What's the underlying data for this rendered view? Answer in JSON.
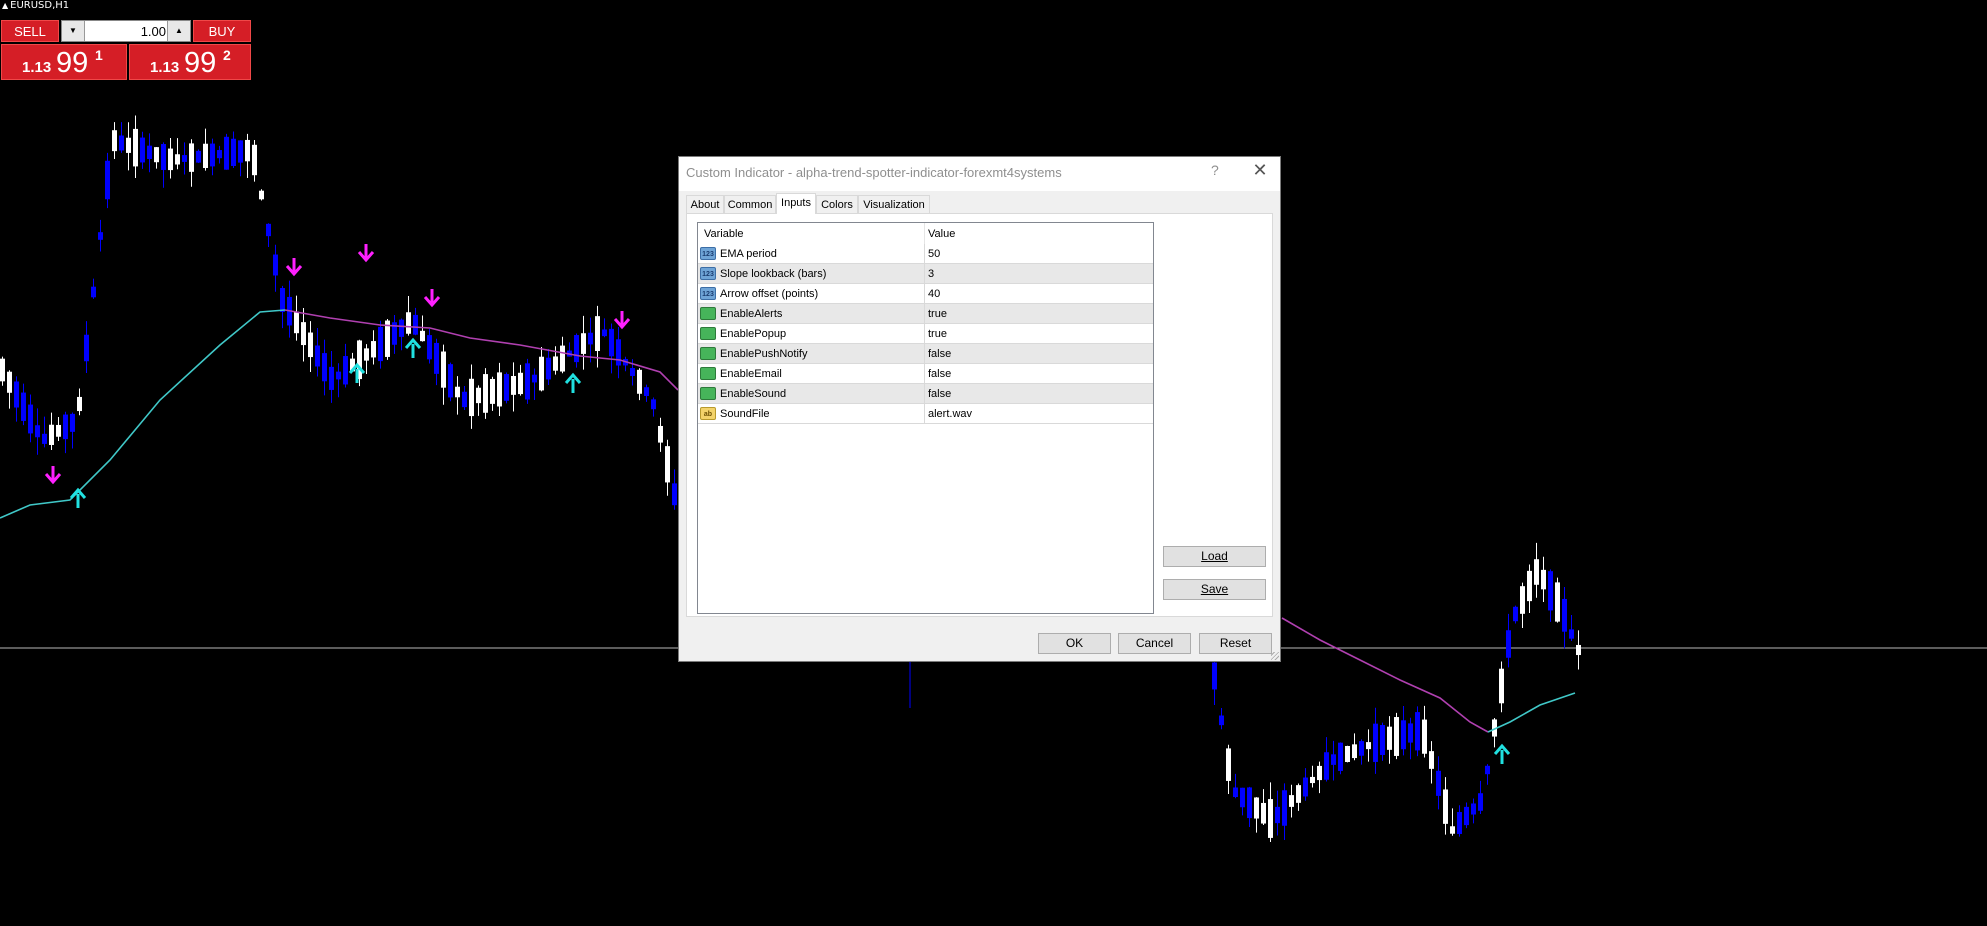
{
  "symbol": "EURUSD,H1",
  "trade_panel": {
    "sell_label": "SELL",
    "buy_label": "BUY",
    "lot_value": "1.00",
    "sell_price": {
      "small": "1.13",
      "big": "99",
      "sup": "1"
    },
    "buy_price": {
      "small": "1.13",
      "big": "99",
      "sup": "2"
    }
  },
  "dialog": {
    "title": "Custom Indicator - alpha-trend-spotter-indicator-forexmt4systems",
    "help": "?",
    "close": "✕",
    "tabs": [
      "About",
      "Common",
      "Inputs",
      "Colors",
      "Visualization"
    ],
    "active_tab": "Inputs",
    "grid": {
      "col_variable": "Variable",
      "col_value": "Value",
      "rows": [
        {
          "type": "num",
          "icon": "123",
          "name": "EMA period",
          "value": "50"
        },
        {
          "type": "num",
          "icon": "123",
          "name": "Slope lookback (bars)",
          "value": "3"
        },
        {
          "type": "num",
          "icon": "123",
          "name": "Arrow offset (points)",
          "value": "40"
        },
        {
          "type": "bool",
          "icon": "",
          "name": "EnableAlerts",
          "value": "true"
        },
        {
          "type": "bool",
          "icon": "",
          "name": "EnablePopup",
          "value": "true"
        },
        {
          "type": "bool",
          "icon": "",
          "name": "EnablePushNotify",
          "value": "false"
        },
        {
          "type": "bool",
          "icon": "",
          "name": "EnableEmail",
          "value": "false"
        },
        {
          "type": "bool",
          "icon": "",
          "name": "EnableSound",
          "value": "false"
        },
        {
          "type": "str",
          "icon": "ab",
          "name": "SoundFile",
          "value": "alert.wav"
        }
      ]
    },
    "buttons": {
      "load": "Load",
      "save": "Save",
      "ok": "OK",
      "cancel": "Cancel",
      "reset": "Reset"
    }
  },
  "colors": {
    "background": "#000000",
    "bull_candle": "#ffffff",
    "bear_candle": "#0000ff",
    "ema_up": "#40c8c8",
    "ema_down": "#b040b0",
    "arrow_buy": "#20e0e0",
    "arrow_sell": "#ff20ff",
    "panel_red": "#d51e26"
  }
}
